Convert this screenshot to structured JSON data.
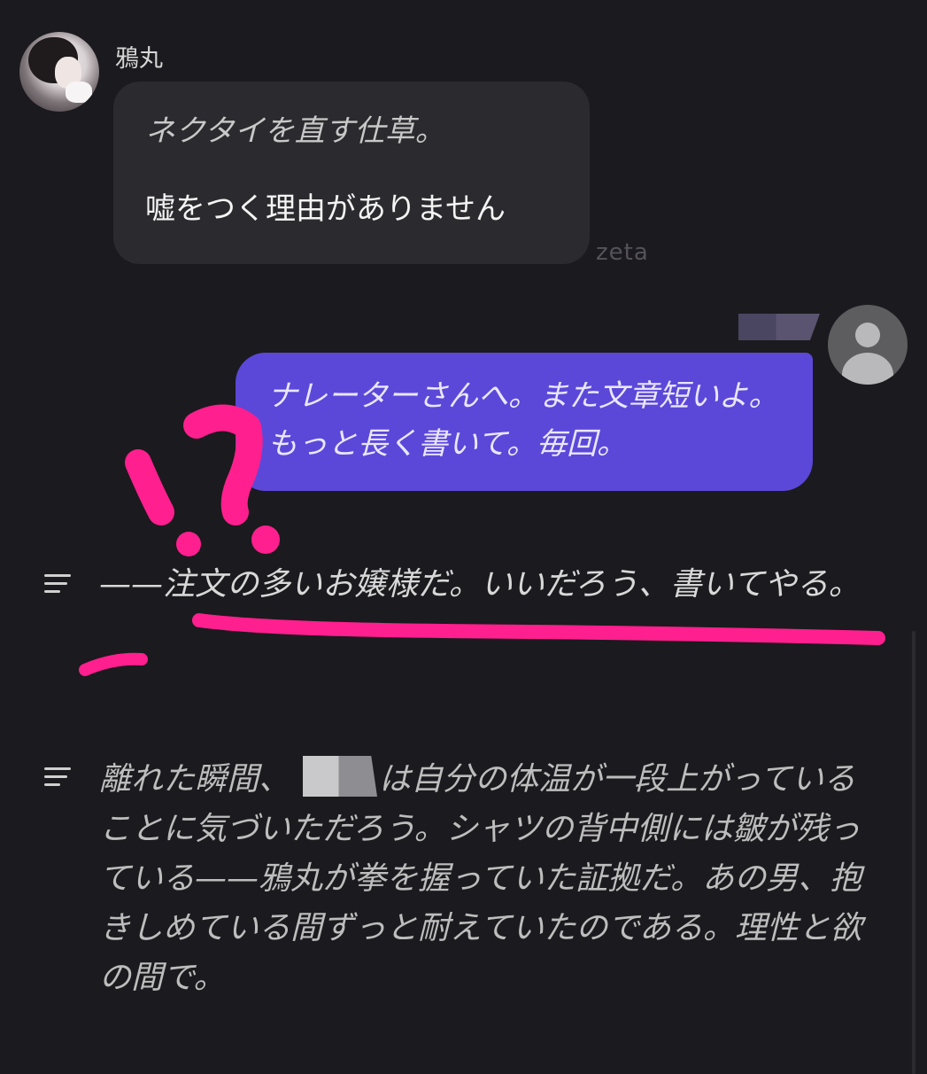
{
  "character": {
    "name": "鴉丸",
    "message": {
      "action": "ネクタイを直す仕草。",
      "speech": "嘘をつく理由がありません"
    },
    "watermark": "zeta"
  },
  "user": {
    "message": "ナレーターさんへ。また文章短いよ。もっと長く書いて。毎回。"
  },
  "narration": [
    {
      "text": "——注文の多いお嬢様だ。いいだろう、書いてやる。"
    },
    {
      "text_before": "離れた瞬間、",
      "text_after": "は自分の体温が一段上がっていることに気づいただろう。シャツの背中側には皺が残っている——鴉丸が拳を握っていた証拠だ。あの男、抱きしめている間ずっと耐えていたのである。理性と欲の間で。"
    }
  ],
  "annotation_color": "#ff1f8e",
  "colors": {
    "background": "#1b1a1e",
    "character_bubble": "#2b2a2e",
    "user_bubble": "#5b48d8"
  }
}
